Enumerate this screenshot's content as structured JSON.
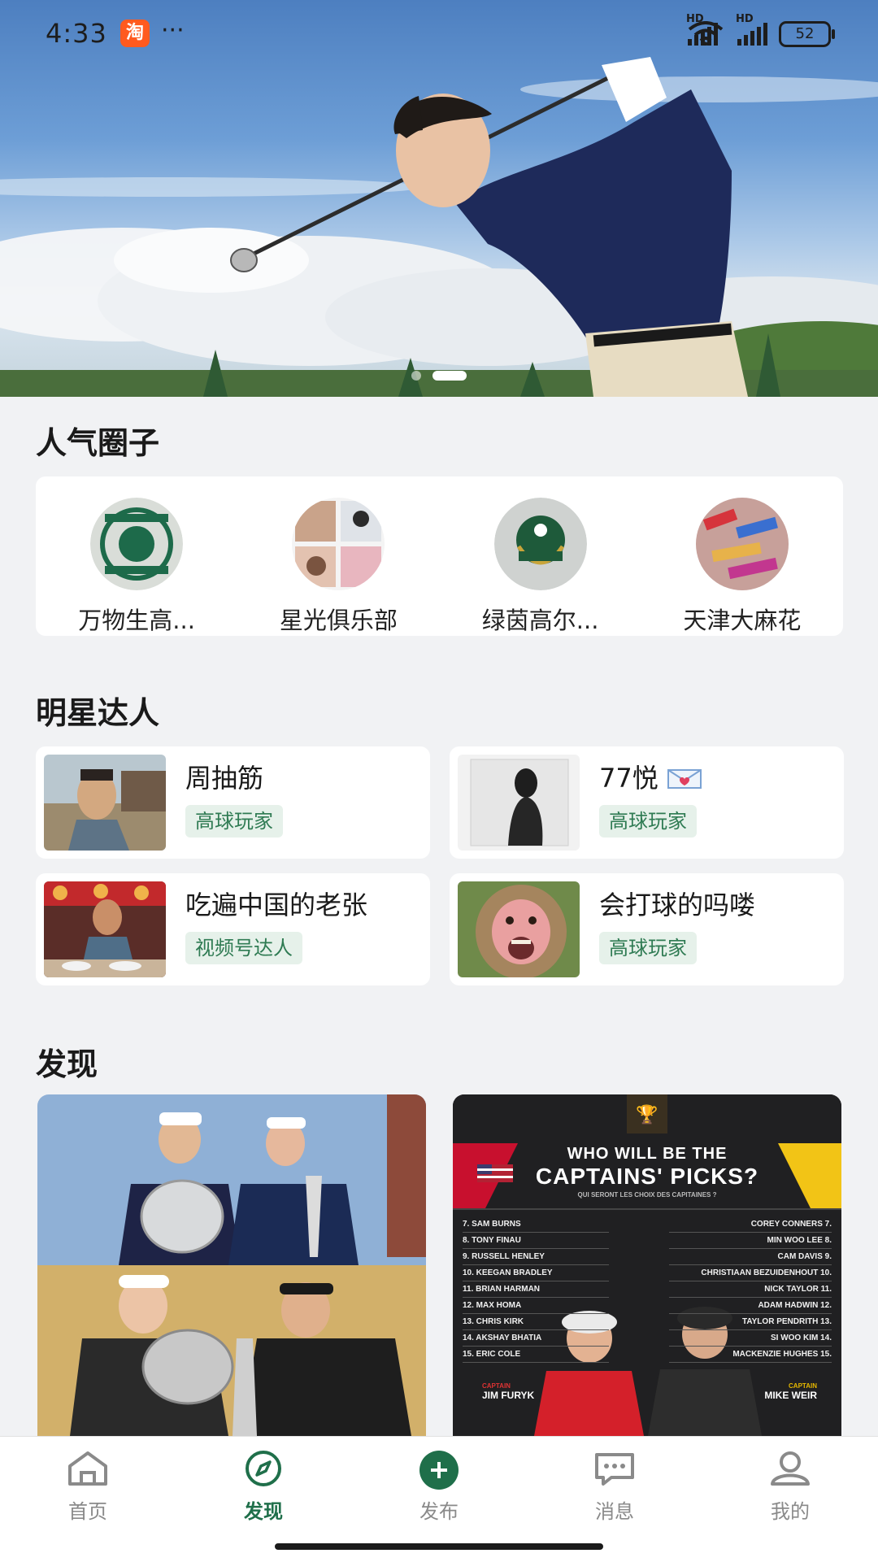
{
  "status_bar": {
    "time": "4:33",
    "app_badge": "淘",
    "more": "···",
    "network_1": "HD",
    "network_2": "HD",
    "battery": "52"
  },
  "banner": {
    "page_count": 2,
    "active_page": 2
  },
  "popular_circles": {
    "title": "人气圈子",
    "items": [
      {
        "name": "万物生高..."
      },
      {
        "name": "星光俱乐部"
      },
      {
        "name": "绿茵高尔..."
      },
      {
        "name": "天津大麻花"
      }
    ]
  },
  "stars": {
    "title": "明星达人",
    "items": [
      {
        "name": "周抽筋",
        "tag": "高球玩家"
      },
      {
        "name": "77悦",
        "tag": "高球玩家"
      },
      {
        "name": "吃遍中国的老张",
        "tag": "视频号达人"
      },
      {
        "name": "会打球的吗喽",
        "tag": "高球玩家"
      }
    ]
  },
  "discover": {
    "title": "发现",
    "card2": {
      "headline_1": "WHO WILL BE THE",
      "headline_2": "CAPTAINS' PICKS?",
      "subtitle": "QUI SERONT LES CHOIX DES CAPITAINES ?",
      "left_list": [
        "7. SAM BURNS",
        "8. TONY FINAU",
        "9. RUSSELL HENLEY",
        "10. KEEGAN BRADLEY",
        "11. BRIAN HARMAN",
        "12. MAX HOMA",
        "13. CHRIS KIRK",
        "14. AKSHAY BHATIA",
        "15. ERIC COLE"
      ],
      "right_list": [
        "COREY CONNERS 7.",
        "MIN WOO LEE 8.",
        "CAM DAVIS 9.",
        "CHRISTIAAN BEZUIDENHOUT 10.",
        "NICK TAYLOR 11.",
        "ADAM HADWIN 12.",
        "TAYLOR PENDRITH 13.",
        "SI WOO KIM 14.",
        "MACKENZIE HUGHES 15."
      ],
      "captain_label": "CAPTAIN",
      "captain_left": "JIM FURYK",
      "captain_right": "MIKE WEIR"
    }
  },
  "tabbar": {
    "items": [
      {
        "label": "首页",
        "icon": "home-icon"
      },
      {
        "label": "发现",
        "icon": "compass-icon"
      },
      {
        "label": "发布",
        "icon": "plus-icon"
      },
      {
        "label": "消息",
        "icon": "chat-icon"
      },
      {
        "label": "我的",
        "icon": "user-icon"
      }
    ],
    "active": "发现",
    "active_color": "#1f6f4a"
  }
}
